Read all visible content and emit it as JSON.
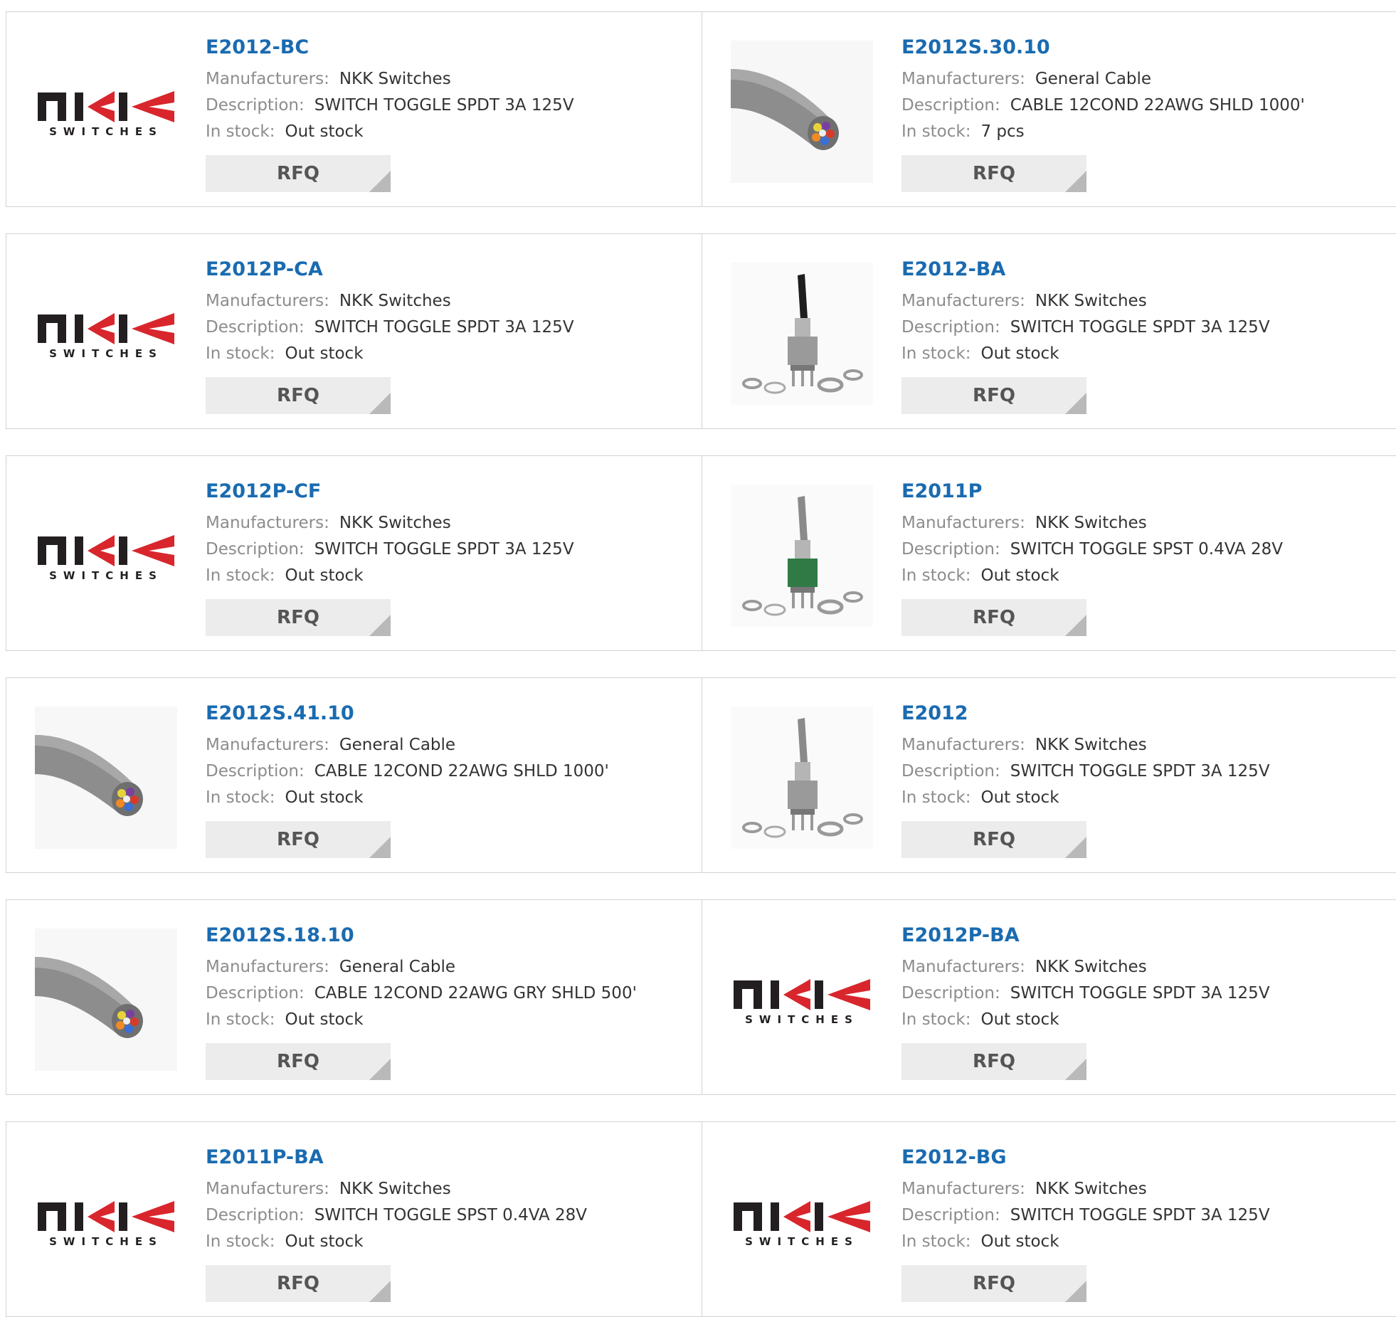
{
  "products": [
    {
      "part": "E2012-BC",
      "image": "nkk-logo",
      "manufacturer_label": "Manufacturers:",
      "manufacturer": "NKK Switches",
      "description_label": "Description:",
      "description": "SWITCH TOGGLE SPDT 3A 125V",
      "stock_label": "In stock:",
      "stock": "Out stock",
      "rfq_label": "RFQ"
    },
    {
      "part": "E2012S.30.10",
      "image": "cable",
      "manufacturer_label": "Manufacturers:",
      "manufacturer": "General Cable",
      "description_label": "Description:",
      "description": "CABLE 12COND 22AWG SHLD 1000'",
      "stock_label": "In stock:",
      "stock": "7 pcs",
      "rfq_label": "RFQ"
    },
    {
      "part": "E2012P-CA",
      "image": "nkk-logo",
      "manufacturer_label": "Manufacturers:",
      "manufacturer": "NKK Switches",
      "description_label": "Description:",
      "description": "SWITCH TOGGLE SPDT 3A 125V",
      "stock_label": "In stock:",
      "stock": "Out stock",
      "rfq_label": "RFQ"
    },
    {
      "part": "E2012-BA",
      "image": "toggle-black",
      "manufacturer_label": "Manufacturers:",
      "manufacturer": "NKK Switches",
      "description_label": "Description:",
      "description": "SWITCH TOGGLE SPDT 3A 125V",
      "stock_label": "In stock:",
      "stock": "Out stock",
      "rfq_label": "RFQ"
    },
    {
      "part": "E2012P-CF",
      "image": "nkk-logo",
      "manufacturer_label": "Manufacturers:",
      "manufacturer": "NKK Switches",
      "description_label": "Description:",
      "description": "SWITCH TOGGLE SPDT 3A 125V",
      "stock_label": "In stock:",
      "stock": "Out stock",
      "rfq_label": "RFQ"
    },
    {
      "part": "E2011P",
      "image": "toggle-green",
      "manufacturer_label": "Manufacturers:",
      "manufacturer": "NKK Switches",
      "description_label": "Description:",
      "description": "SWITCH TOGGLE SPST 0.4VA 28V",
      "stock_label": "In stock:",
      "stock": "Out stock",
      "rfq_label": "RFQ"
    },
    {
      "part": "E2012S.41.10",
      "image": "cable",
      "manufacturer_label": "Manufacturers:",
      "manufacturer": "General Cable",
      "description_label": "Description:",
      "description": "CABLE 12COND 22AWG SHLD 1000'",
      "stock_label": "In stock:",
      "stock": "Out stock",
      "rfq_label": "RFQ"
    },
    {
      "part": "E2012",
      "image": "toggle-silver",
      "manufacturer_label": "Manufacturers:",
      "manufacturer": "NKK Switches",
      "description_label": "Description:",
      "description": "SWITCH TOGGLE SPDT 3A 125V",
      "stock_label": "In stock:",
      "stock": "Out stock",
      "rfq_label": "RFQ"
    },
    {
      "part": "E2012S.18.10",
      "image": "cable",
      "manufacturer_label": "Manufacturers:",
      "manufacturer": "General Cable",
      "description_label": "Description:",
      "description": "CABLE 12COND 22AWG GRY SHLD 500'",
      "stock_label": "In stock:",
      "stock": "Out stock",
      "rfq_label": "RFQ"
    },
    {
      "part": "E2012P-BA",
      "image": "nkk-logo",
      "manufacturer_label": "Manufacturers:",
      "manufacturer": "NKK Switches",
      "description_label": "Description:",
      "description": "SWITCH TOGGLE SPDT 3A 125V",
      "stock_label": "In stock:",
      "stock": "Out stock",
      "rfq_label": "RFQ"
    },
    {
      "part": "E2011P-BA",
      "image": "nkk-logo",
      "manufacturer_label": "Manufacturers:",
      "manufacturer": "NKK Switches",
      "description_label": "Description:",
      "description": "SWITCH TOGGLE SPST 0.4VA 28V",
      "stock_label": "In stock:",
      "stock": "Out stock",
      "rfq_label": "RFQ"
    },
    {
      "part": "E2012-BG",
      "image": "nkk-logo",
      "manufacturer_label": "Manufacturers:",
      "manufacturer": "NKK Switches",
      "description_label": "Description:",
      "description": "SWITCH TOGGLE SPDT 3A 125V",
      "stock_label": "In stock:",
      "stock": "Out stock",
      "rfq_label": "RFQ"
    }
  ],
  "logo_text": "SWITCHES",
  "colors": {
    "part_link": "#1a6bb0",
    "label": "#8c8c8c",
    "value": "#333333",
    "logo_red": "#d8262c",
    "logo_dark": "#231f20",
    "rfq_bg": "#ececec"
  }
}
